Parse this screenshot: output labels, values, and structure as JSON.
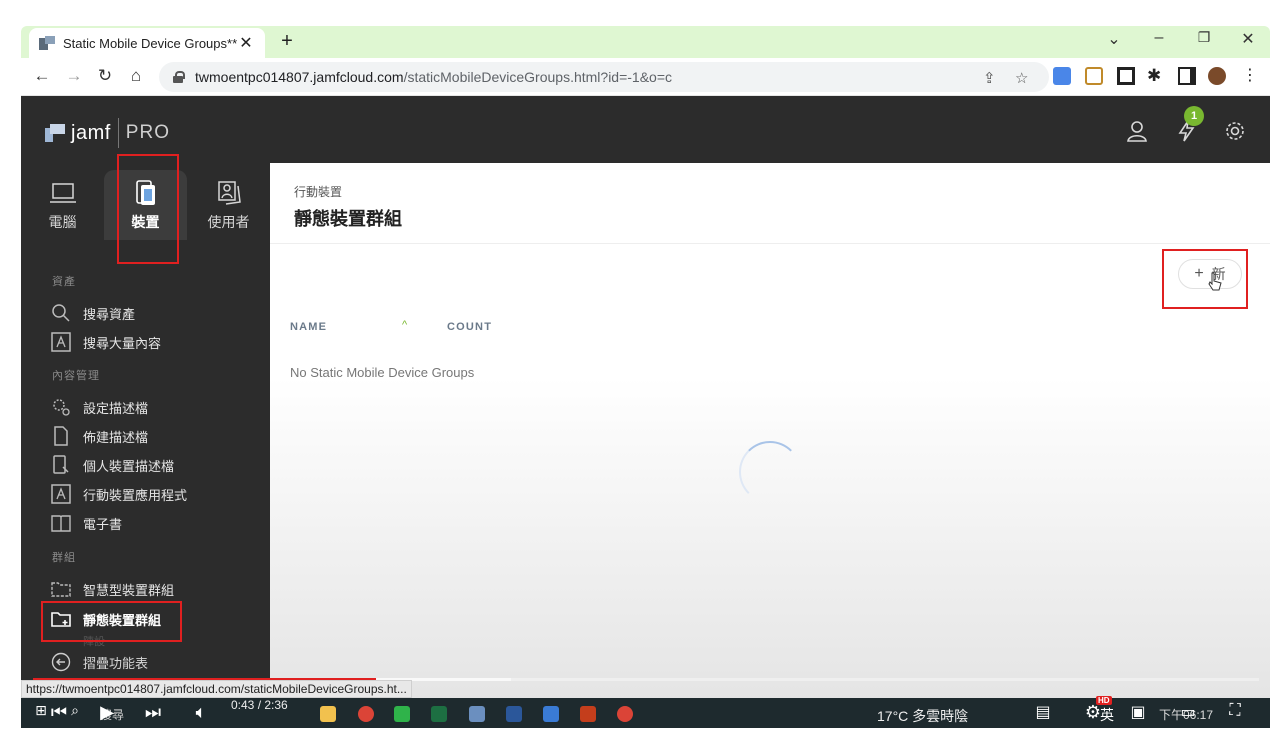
{
  "browser": {
    "tab_title": "Static Mobile Device Groups**",
    "tab_close": "✕",
    "new_tab": "+",
    "url_host": "twmoentpc014807.jamfcloud.com",
    "url_path": "/staticMobileDeviceGroups.html?id=-1&o=c",
    "nav": {
      "back": "←",
      "forward": "→",
      "reload": "↻",
      "home": "⌂"
    },
    "window": {
      "tablist": "⌄",
      "minimize": "–",
      "restore": "❐",
      "close": "✕"
    }
  },
  "header": {
    "logo_word": "jamf",
    "logo_pro": "PRO",
    "notification_count": "1"
  },
  "sidebar": {
    "categories": [
      {
        "label": "電腦",
        "icon": "laptop-icon"
      },
      {
        "label": "裝置",
        "icon": "mobile-device-icon"
      },
      {
        "label": "使用者",
        "icon": "users-icon"
      }
    ],
    "sections": [
      {
        "label": "資產"
      },
      {
        "label": "內容管理"
      },
      {
        "label": "群組"
      }
    ],
    "items": [
      {
        "label": "搜尋資產",
        "icon": "search-icon"
      },
      {
        "label": "搜尋大量內容",
        "icon": "app-store-icon"
      },
      {
        "label": "設定描述檔",
        "icon": "settings-profile-icon"
      },
      {
        "label": "佈建描述檔",
        "icon": "provisioning-profile-icon"
      },
      {
        "label": "個人裝置描述檔",
        "icon": "personal-device-icon"
      },
      {
        "label": "行動裝置應用程式",
        "icon": "mobile-app-icon"
      },
      {
        "label": "電子書",
        "icon": "ebook-icon"
      },
      {
        "label": "智慧型裝置群組",
        "icon": "smart-group-folder-icon"
      },
      {
        "label": "靜態裝置群組",
        "icon": "static-group-folder-icon"
      },
      {
        "label": "陣設"
      }
    ],
    "collapse_label": "摺疊功能表"
  },
  "main": {
    "breadcrumb": "行動裝置",
    "title": "靜態裝置群組",
    "new_button_label": "新",
    "new_button_plus": "+",
    "columns": [
      "NAME",
      "COUNT"
    ],
    "sort_indicator": "^",
    "empty_message": "No Static Mobile Device Groups"
  },
  "status_url": "https://twmoentpc014807.jamfcloud.com/staticMobileDeviceGroups.ht...",
  "video": {
    "time": "0:43 / 2:36",
    "played_fraction": 0.28,
    "buffered_fraction": 0.39,
    "hd_badge": "HD"
  },
  "taskbar": {
    "search_label": "搜尋",
    "weather": "17°C 多雲時陰",
    "input_method": "英",
    "clock": "下午06:17"
  },
  "colors": {
    "annotation_red": "#e02020",
    "jamf_dark": "#2c2c2c",
    "accent_green": "#79b830",
    "tabstrip_green": "#dff7d2"
  }
}
